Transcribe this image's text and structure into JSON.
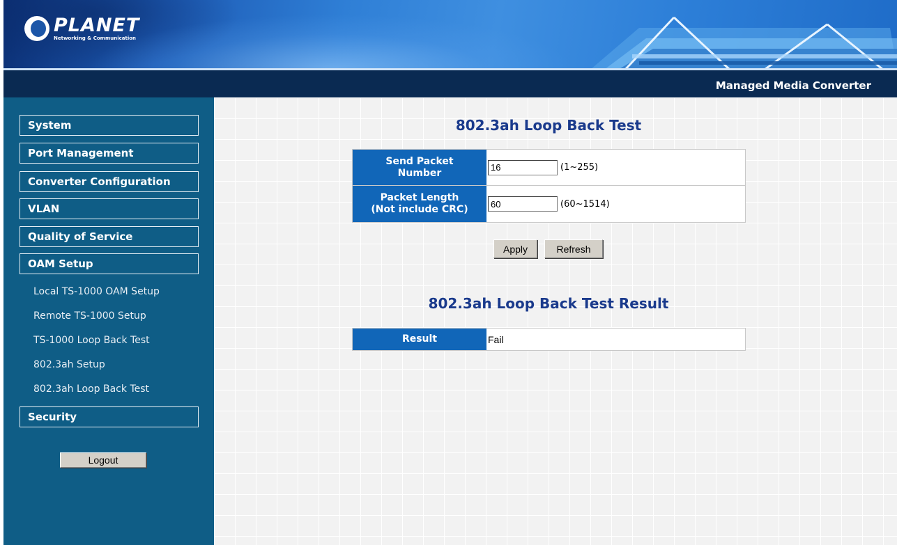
{
  "header": {
    "brand_name": "PLANET",
    "brand_tagline": "Networking & Communication",
    "product_name": "Managed Media Converter"
  },
  "sidebar": {
    "menu": [
      {
        "label": "System"
      },
      {
        "label": "Port Management"
      },
      {
        "label": "Converter Configuration"
      },
      {
        "label": "VLAN"
      },
      {
        "label": "Quality of Service"
      },
      {
        "label": "OAM Setup"
      }
    ],
    "oam_submenu": [
      {
        "label": "Local TS-1000 OAM Setup"
      },
      {
        "label": "Remote TS-1000 Setup"
      },
      {
        "label": "TS-1000 Loop Back Test"
      },
      {
        "label": "802.3ah Setup"
      },
      {
        "label": "802.3ah Loop Back Test"
      }
    ],
    "security_label": "Security",
    "logout_label": "Logout"
  },
  "test_form": {
    "title": "802.3ah Loop Back Test",
    "send_packet_label_1": "Send Packet",
    "send_packet_label_2": "Number",
    "send_packet_value": "16",
    "send_packet_range": "(1~255)",
    "packet_length_label_1": "Packet Length",
    "packet_length_label_2": "(Not include CRC)",
    "packet_length_value": "60",
    "packet_length_range": "(60~1514)",
    "apply_label": "Apply",
    "refresh_label": "Refresh"
  },
  "result": {
    "title": "802.3ah Loop Back Test Result",
    "label": "Result",
    "value": "Fail"
  },
  "colors": {
    "sidebar_bg": "#0f5d86",
    "title_bar_bg": "#0a2a52",
    "label_cell_bg": "#1166b8",
    "section_title": "#1a3a8c"
  }
}
